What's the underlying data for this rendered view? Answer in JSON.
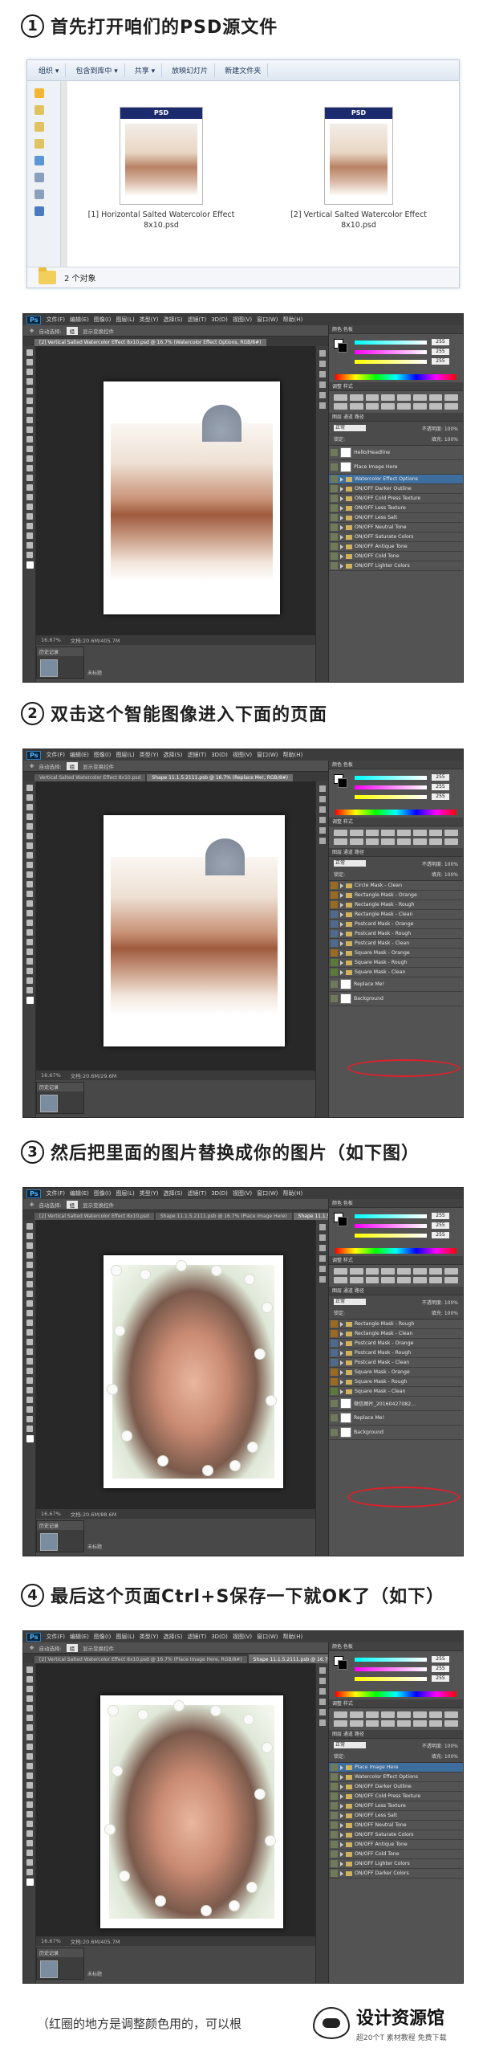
{
  "steps": [
    {
      "num": "1",
      "title": "首先打开咱们的PSD源文件"
    },
    {
      "num": "2",
      "title": "双击这个智能图像进入下面的页面"
    },
    {
      "num": "3",
      "title": "然后把里面的图片替换成你的图片（如下图）"
    },
    {
      "num": "4",
      "title": "最后这个页面Ctrl+S保存一下就OK了（如下）"
    }
  ],
  "explorer": {
    "toolbar": [
      "组织 ▾",
      "包含到库中 ▾",
      "共享 ▾",
      "放映幻灯片",
      "新建文件夹"
    ],
    "files": [
      {
        "band": "PSD",
        "name": "[1] Horizontal Salted Watercolor Effect 8x10.psd"
      },
      {
        "band": "PSD",
        "name": "[2] Vertical Salted Watercolor Effect 8x10.psd"
      }
    ],
    "status": "2 个对象"
  },
  "ps": {
    "logo": "Ps",
    "menu": [
      "文件(F)",
      "编辑(E)",
      "图像(I)",
      "图层(L)",
      "类型(Y)",
      "选择(S)",
      "滤镜(T)",
      "3D(D)",
      "视图(V)",
      "窗口(W)",
      "帮助(H)"
    ],
    "shots": [
      {
        "opt": [
          "自动选择:",
          "组",
          "显示变换控件"
        ],
        "tabs": [
          "[2] Vertical Salted Watercolor Effect 8x10.psd @ 16.7% (Watercolor Effect Options, RGB/8#)"
        ],
        "zoom": "16.67%",
        "doc": "文档:20.6M/405.7M",
        "minitab": "历史记录",
        "mini_label": "未标题",
        "rgb": [
          "255",
          "255",
          "255"
        ],
        "mode": "正常",
        "opacity": "不透明度: 100%",
        "fill": "填充: 100%",
        "lock": "锁定:",
        "layers": [
          "Hello/Headline",
          "Place Image Here",
          "Watercolor Effect Options",
          "ON/OFF Darker Outline",
          "ON/OFF Cold Press Texture",
          "ON/OFF Less Texture",
          "ON/OFF Less Salt",
          "ON/OFF Neutral Tone",
          "ON/OFF Saturate Colors",
          "ON/OFF Antique Tone",
          "ON/OFF Cold Tone",
          "ON/OFF Lighter Colors"
        ]
      },
      {
        "opt": [
          "自动选择:",
          "组",
          "显示变换控件"
        ],
        "tabs": [
          "Vertical Salted Watercolor Effect 8x10.psd",
          "Shape 11.1.5.2111.psb @ 16.7% (Replace Me!, RGB/8#)"
        ],
        "zoom": "16.67%",
        "doc": "文档:20.6M/29.6M",
        "minitab": "历史记录",
        "mini_label": "",
        "rgb": [
          "255",
          "255",
          "255"
        ],
        "mode": "正常",
        "opacity": "不透明度: 100%",
        "fill": "填充: 100%",
        "lock": "锁定:",
        "layers": [
          "Circle Mask - Clean",
          "Rectangle Mask - Orange",
          "Rectangle Mask - Rough",
          "Rectangle Mask - Clean",
          "Postcard Mask - Orange",
          "Postcard Mask - Rough",
          "Postcard Mask - Clean",
          "Square Mask - Orange",
          "Square Mask - Rough",
          "Square Mask - Clean",
          "Replace Me!",
          "Background"
        ]
      },
      {
        "opt": [
          "自动选择:",
          "组",
          "显示变换控件"
        ],
        "tabs": [
          "[2] Vertical Salted Watercolor Effect 8x10.psd",
          "Shape 11.1.5.2111.psb @ 16.7% (Place Image Here)",
          "Shape 11.1.5"
        ],
        "zoom": "16.67%",
        "doc": "文档:20.6M/88.6M",
        "minitab": "历史记录",
        "mini_label": "未标题",
        "rgb": [
          "255",
          "255",
          "255"
        ],
        "mode": "正常",
        "opacity": "不透明度: 100%",
        "fill": "填充: 100%",
        "lock": "锁定:",
        "layers": [
          "Rectangle Mask - Rough",
          "Rectangle Mask - Clean",
          "Postcard Mask - Orange",
          "Postcard Mask - Rough",
          "Postcard Mask - Clean",
          "Square Mask - Orange",
          "Square Mask - Rough",
          "Square Mask - Clean",
          "微信图片_20160427082...",
          "Replace Me!",
          "Background"
        ]
      },
      {
        "opt": [
          "自动选择:",
          "组",
          "显示变换控件"
        ],
        "tabs": [
          "[2] Vertical Salted Watercolor Effect 8x10.psd @ 16.7% (Place Image Here, RGB/8#)",
          "Shape 11.1.5.2111.psb @ 16.7% (微信图片_20160427082612, RGB/8#)"
        ],
        "zoom": "16.67%",
        "doc": "文档:20.6M/405.7M",
        "minitab": "历史记录",
        "mini_label": "未标题",
        "rgb": [
          "255",
          "255",
          "255"
        ],
        "mode": "正常",
        "opacity": "不透明度: 100%",
        "fill": "填充: 100%",
        "lock": "锁定:",
        "layers": [
          "Place Image Here",
          "Watercolor Effect Options",
          "ON/OFF Darker Outline",
          "ON/OFF Cold Press Texture",
          "ON/OFF Less Texture",
          "ON/OFF Less Salt",
          "ON/OFF Neutral Tone",
          "ON/OFF Saturate Colors",
          "ON/OFF Antique Tone",
          "ON/OFF Cold Tone",
          "ON/OFF Lighter Colors",
          "ON/OFF Darker Colors"
        ]
      }
    ]
  },
  "caption": "（红圈的地方是调整颜色用的，可以根",
  "watermark": {
    "title": "设计资源馆",
    "sub": "超20个T 素材教程 免费下载"
  }
}
